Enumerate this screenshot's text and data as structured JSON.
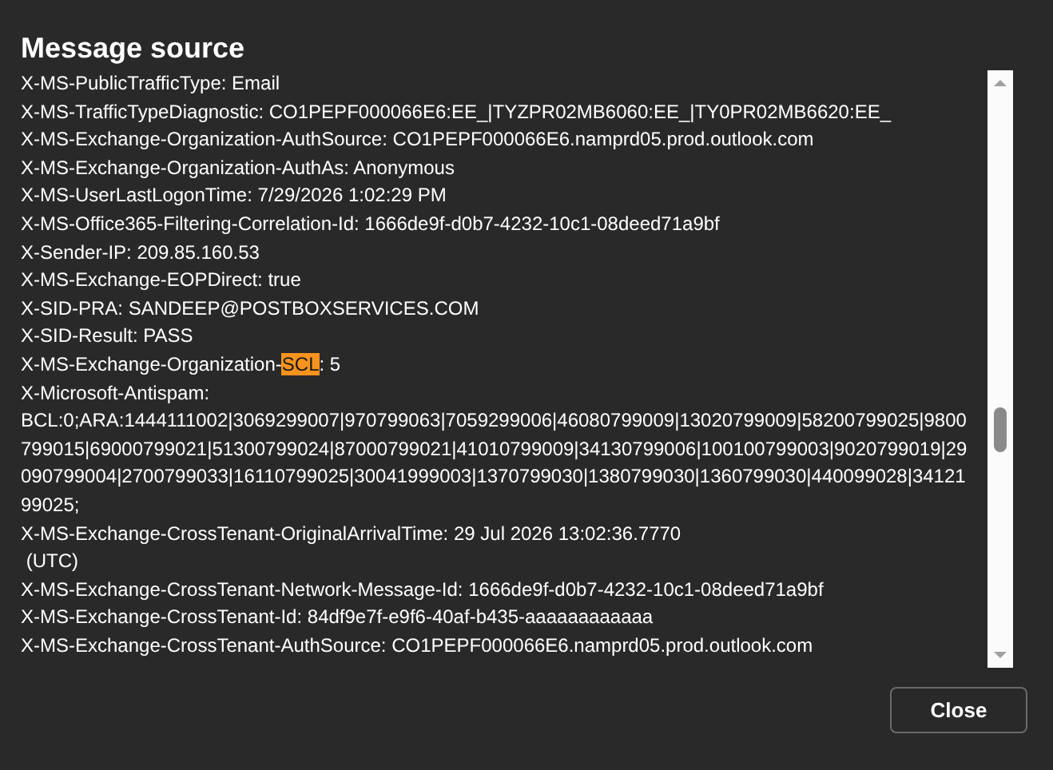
{
  "dialog": {
    "title": "Message source",
    "lines": [
      {
        "kind": "plain",
        "text": "X-MS-PublicTrafficType: Email"
      },
      {
        "kind": "plain",
        "text": "X-MS-TrafficTypeDiagnostic: CO1PEPF000066E6:EE_|TYZPR02MB6060:EE_|TY0PR02MB6620:EE_"
      },
      {
        "kind": "plain",
        "text": "X-MS-Exchange-Organization-AuthSource: CO1PEPF000066E6.namprd05.prod.outlook.com"
      },
      {
        "kind": "plain",
        "text": "X-MS-Exchange-Organization-AuthAs: Anonymous"
      },
      {
        "kind": "plain",
        "text": "X-MS-UserLastLogonTime: 7/29/2026 1:02:29 PM"
      },
      {
        "kind": "plain",
        "text": "X-MS-Office365-Filtering-Correlation-Id: 1666de9f-d0b7-4232-10c1-08deed71a9bf"
      },
      {
        "kind": "plain",
        "text": "X-Sender-IP: 209.85.160.53"
      },
      {
        "kind": "plain",
        "text": "X-MS-Exchange-EOPDirect: true"
      },
      {
        "kind": "plain",
        "text": "X-SID-PRA: SANDEEP@POSTBOXSERVICES.COM"
      },
      {
        "kind": "plain",
        "text": "X-SID-Result: PASS"
      },
      {
        "kind": "parts",
        "parts": [
          {
            "text": "X-MS-Exchange-Organization-",
            "highlighted": false
          },
          {
            "text": "SCL",
            "highlighted": true
          },
          {
            "text": ": 5",
            "highlighted": false
          }
        ]
      },
      {
        "kind": "plain",
        "text": "X-Microsoft-Antispam:"
      },
      {
        "kind": "plain",
        "text": "BCL:0;ARA:1444111002|3069299007|970799063|7059299006|46080799009|13020799009|58200799025|9800"
      },
      {
        "kind": "plain",
        "text": "799015|69000799021|51300799024|87000799021|41010799009|34130799006|100100799003|9020799019|29"
      },
      {
        "kind": "plain",
        "text": "090799004|2700799033|16110799025|30041999003|1370799030|1380799030|1360799030|440099028|34121"
      },
      {
        "kind": "plain",
        "text": "99025;"
      },
      {
        "kind": "plain",
        "text": "X-MS-Exchange-CrossTenant-OriginalArrivalTime: 29 Jul 2026 13:02:36.7770"
      },
      {
        "kind": "plain",
        "text": " (UTC)"
      },
      {
        "kind": "plain",
        "text": "X-MS-Exchange-CrossTenant-Network-Message-Id: 1666de9f-d0b7-4232-10c1-08deed71a9bf"
      },
      {
        "kind": "plain",
        "text": "X-MS-Exchange-CrossTenant-Id: 84df9e7f-e9f6-40af-b435-aaaaaaaaaaaa"
      },
      {
        "kind": "plain",
        "text": "X-MS-Exchange-CrossTenant-AuthSource: CO1PEPF000066E6.namprd05.prod.outlook.com"
      }
    ],
    "buttons": [
      {
        "label": "Close"
      }
    ]
  }
}
